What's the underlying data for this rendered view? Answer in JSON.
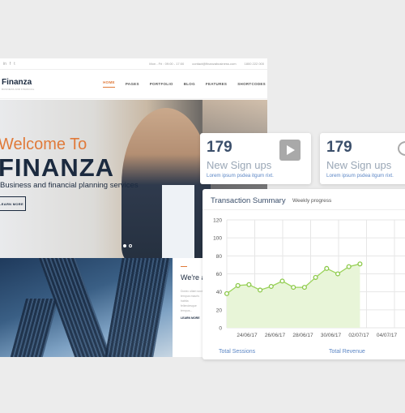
{
  "site": {
    "topbar": {
      "social": [
        "in",
        "f",
        "t"
      ],
      "hours": "Mon - Fri : 09:00 - 17:00",
      "email": "contact@finanzabusiness.com",
      "phone": "1800 222 000"
    },
    "brand": {
      "name": "Finanza",
      "tagline": "BUSINESS AND FINANCIAL"
    },
    "menu": [
      "HOME",
      "PAGES",
      "PORTFOLIO",
      "BLOG",
      "FEATURES",
      "SHORTCODES"
    ],
    "hero": {
      "title_line1": "Welcome To",
      "title_line2": "FINANZA",
      "subtitle": "Business and financial planning services",
      "button": "LEARN MORE"
    },
    "feature": {
      "heading": "We're a money",
      "body": "Donec ullam socio tempus mauris habita fellendesque tempus...",
      "more": "LEARN MORE"
    }
  },
  "stats": [
    {
      "value": "179",
      "label": "New Sign ups",
      "desc": "Lorem ipsum psdea itgum rixt.",
      "icon": "play-icon"
    },
    {
      "value": "179",
      "label": "New Sign ups",
      "desc": "Lorem ipsum psdea itgum rixt.",
      "icon": "chat-icon"
    }
  ],
  "chart_panel": {
    "title": "Transaction Summary",
    "subtitle": "Weekly progress",
    "footer_left": "Total Sessions",
    "footer_right": "Total Revenue"
  },
  "chart_data": {
    "type": "area",
    "title": "Transaction Summary",
    "ylim": [
      0,
      120
    ],
    "yticks": [
      0,
      20,
      40,
      60,
      80,
      100,
      120
    ],
    "xticks": [
      "24/06/17",
      "26/06/17",
      "28/06/17",
      "30/06/17",
      "02/07/17",
      "04/07/17"
    ],
    "values": [
      38,
      47,
      48,
      42,
      46,
      52,
      45,
      45,
      56,
      66,
      60,
      68,
      71
    ],
    "colors": {
      "line": "#9bd35a",
      "fill": "#e8f5d8",
      "marker": "#8cc94a"
    },
    "grid": true
  }
}
